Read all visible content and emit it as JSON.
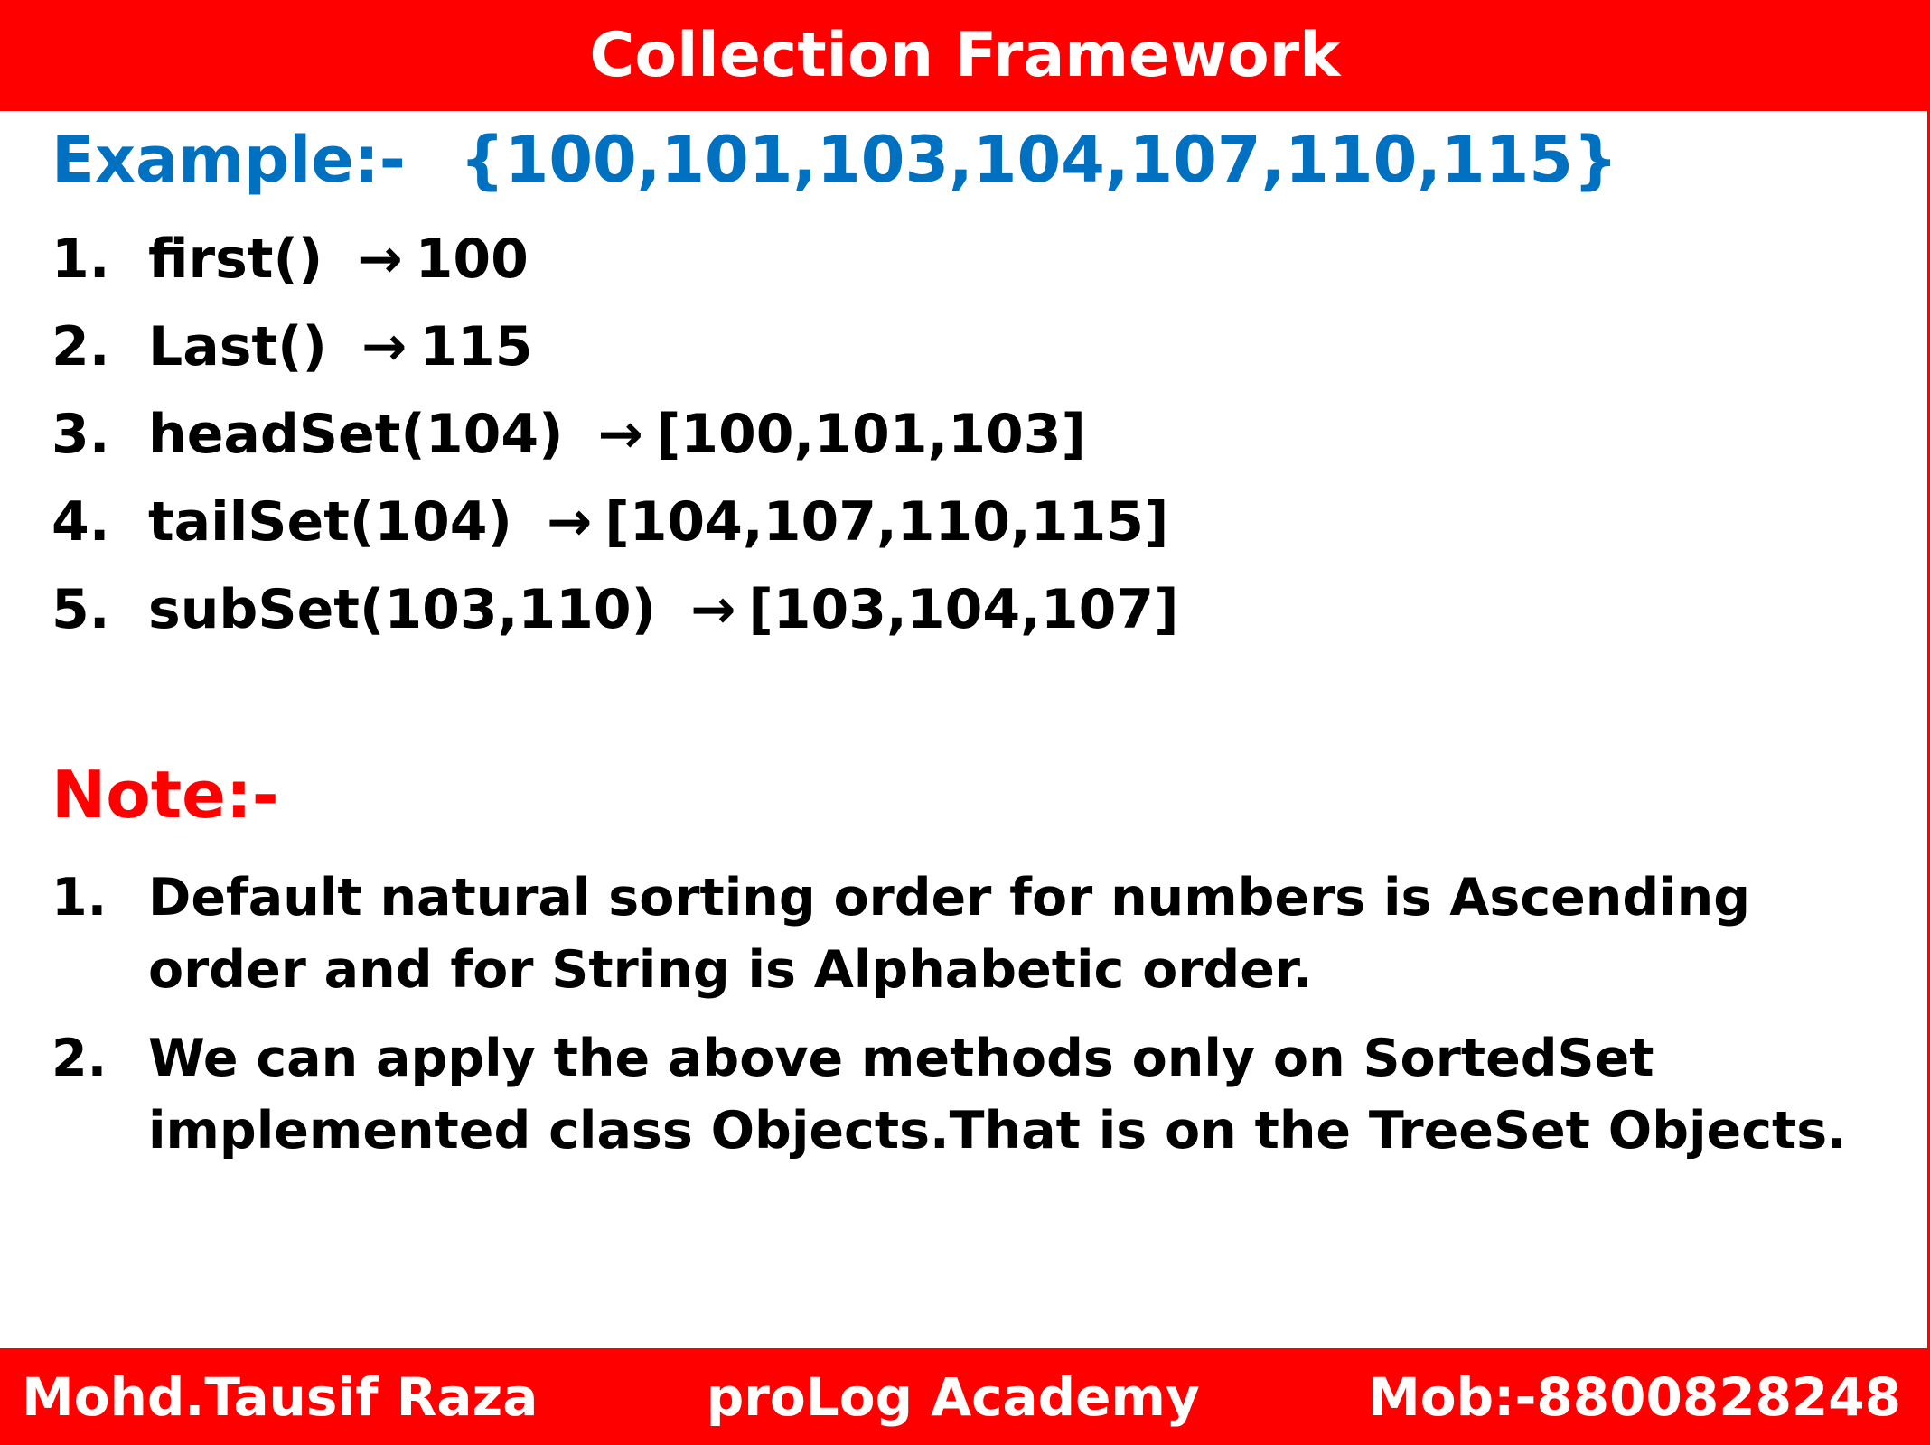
{
  "header": {
    "title": "Collection Framework"
  },
  "example": {
    "label": "Example:-",
    "set": "{100,101,103,104,107,110,115}",
    "arrow_glyph": "→",
    "items": [
      {
        "number": "1.",
        "method": "first()",
        "result": "100"
      },
      {
        "number": "2.",
        "method": "Last()",
        "result": "115"
      },
      {
        "number": "3.",
        "method": "headSet(104)",
        "result": "[100,101,103]"
      },
      {
        "number": "4.",
        "method": "tailSet(104)",
        "result": "[104,107,110,115]"
      },
      {
        "number": "5.",
        "method": "subSet(103,110)",
        "result": "[103,104,107]"
      }
    ]
  },
  "note": {
    "label": "Note:-",
    "items": [
      {
        "number": "1.",
        "text": "Default natural sorting order for numbers is Ascending order and for String is Alphabetic order."
      },
      {
        "number": "2.",
        "text": "We can apply the above methods only on SortedSet implemented class Objects.That is on the TreeSet Objects."
      }
    ]
  },
  "footer": {
    "author": "Mohd.Tausif Raza",
    "academy": "proLog Academy",
    "mobile": "Mob:-8800828248"
  },
  "colors": {
    "header_bg": "#ff0000",
    "example_heading": "#0070c0",
    "note_heading": "#ff0000",
    "footer_bg": "#ff0000"
  }
}
